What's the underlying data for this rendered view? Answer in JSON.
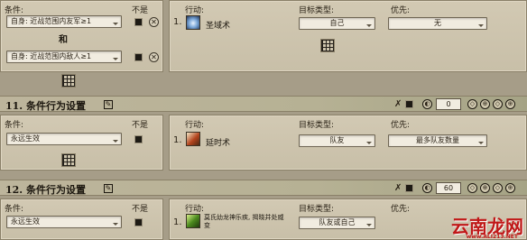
{
  "top_block": {
    "conditions_label": "条件:",
    "not_label": "不是",
    "cond1": "自身: 近战范围内友军≥1",
    "and_text": "和",
    "cond2": "自身: 近战范围内敌人≥1",
    "action_label": "行动:",
    "target_label": "目标类型:",
    "priority_label": "优先:",
    "row_num": "1.",
    "skill": "圣域术",
    "target": "自己",
    "priority": "无"
  },
  "section11": {
    "title": "11. 条件行为设置",
    "number": "0",
    "conditions_label": "条件:",
    "not_label": "不是",
    "cond1": "永远生效",
    "action_label": "行动:",
    "target_label": "目标类型:",
    "priority_label": "优先:",
    "row_num": "1.",
    "skill": "延时术",
    "target": "队友",
    "priority": "最多队友数量"
  },
  "section12": {
    "title": "12. 条件行为设置",
    "number": "60",
    "conditions_label": "条件:",
    "not_label": "不是",
    "cond1": "永远生效",
    "action_label": "行动:",
    "target_label": "目标类型:",
    "priority_label": "优先:",
    "row_num": "1.",
    "skill": "莫氏幼龙神乐疾, 揭晓并处威变",
    "target": "队友或自己"
  },
  "watermark": {
    "text": "云南龙网",
    "url": "www.ALI213.NET"
  },
  "colors": {
    "panel": "#c8bfa8",
    "header": "#b6b194",
    "field": "#f1ece0",
    "watermark": "#c01818"
  }
}
